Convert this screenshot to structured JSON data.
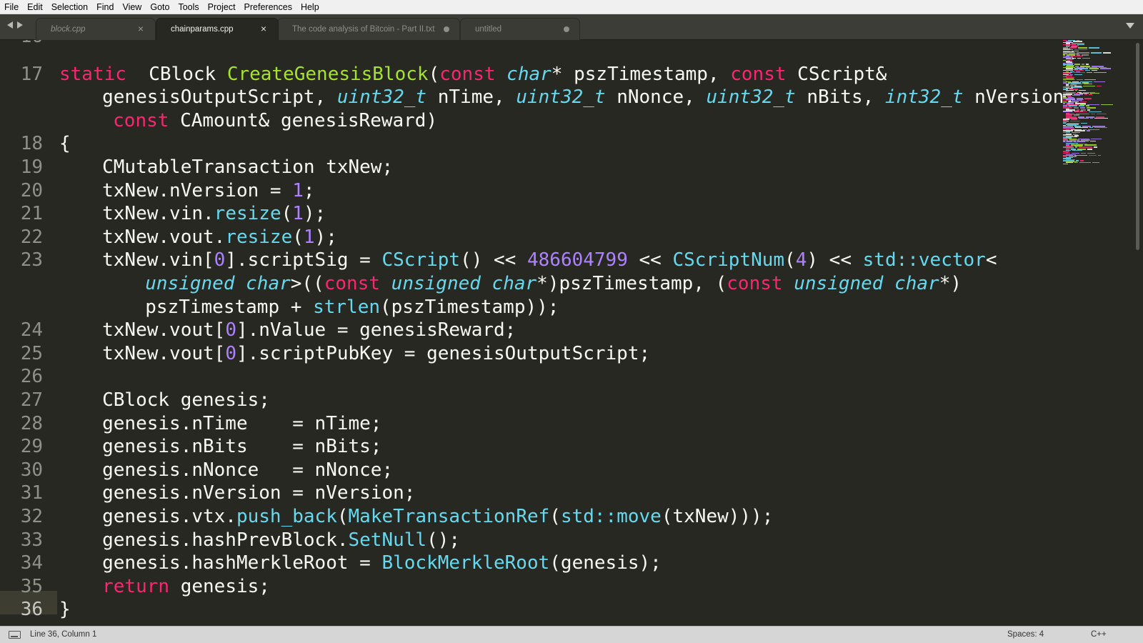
{
  "menu": [
    "File",
    "Edit",
    "Selection",
    "Find",
    "View",
    "Goto",
    "Tools",
    "Project",
    "Preferences",
    "Help"
  ],
  "tabs": [
    {
      "label": "block.cpp",
      "state": "close"
    },
    {
      "label": "chainparams.cpp",
      "state": "close",
      "active": true
    },
    {
      "label": "The code analysis of Bitcoin - Part II.txt",
      "state": "dirty"
    },
    {
      "label": "untitled",
      "state": "dirty"
    }
  ],
  "icons": {
    "nav_back": "triangle-left-icon",
    "nav_forward": "triangle-right-icon",
    "tab_close": "close-icon",
    "tab_dirty": "dot-icon",
    "overflow": "chevron-down-icon",
    "panel": "panel-toggle-icon"
  },
  "gutter": [
    {
      "n": "16",
      "row": -0.6
    },
    {
      "n": "17",
      "row": 1
    },
    {
      "n": "18",
      "row": 4
    },
    {
      "n": "19",
      "row": 5
    },
    {
      "n": "20",
      "row": 6
    },
    {
      "n": "21",
      "row": 7
    },
    {
      "n": "22",
      "row": 8
    },
    {
      "n": "23",
      "row": 9
    },
    {
      "n": "24",
      "row": 12
    },
    {
      "n": "25",
      "row": 13
    },
    {
      "n": "26",
      "row": 14
    },
    {
      "n": "27",
      "row": 15
    },
    {
      "n": "28",
      "row": 16
    },
    {
      "n": "29",
      "row": 17
    },
    {
      "n": "30",
      "row": 18
    },
    {
      "n": "31",
      "row": 19
    },
    {
      "n": "32",
      "row": 20
    },
    {
      "n": "33",
      "row": 21
    },
    {
      "n": "34",
      "row": 22
    },
    {
      "n": "35",
      "row": 23
    },
    {
      "n": "36",
      "row": 24
    }
  ],
  "code": [
    {
      "row": 1,
      "indent": 0,
      "tokens": [
        [
          "kw",
          "static"
        ],
        [
          "",
          "  CBlock "
        ],
        [
          "fn",
          "CreateGenesisBlock"
        ],
        [
          "",
          "("
        ],
        [
          "kw",
          "const"
        ],
        [
          "",
          " "
        ],
        [
          "ty",
          "char"
        ],
        [
          "",
          "* pszTimestamp, "
        ],
        [
          "kw",
          "const"
        ],
        [
          "",
          " CScript&"
        ]
      ]
    },
    {
      "row": 2,
      "indent": 2.4,
      "tokens": [
        [
          "",
          "genesisOutputScript, "
        ],
        [
          "ty",
          "uint32_t"
        ],
        [
          "",
          " nTime, "
        ],
        [
          "ty",
          "uint32_t"
        ],
        [
          "",
          " nNonce, "
        ],
        [
          "ty",
          "uint32_t"
        ],
        [
          "",
          " nBits, "
        ],
        [
          "ty",
          "int32_t"
        ],
        [
          "",
          " nVersion,"
        ]
      ]
    },
    {
      "row": 3,
      "indent": 3,
      "tokens": [
        [
          "kw",
          "const"
        ],
        [
          "",
          " CAmount& genesisReward)"
        ]
      ]
    },
    {
      "row": 4,
      "indent": 0,
      "tokens": [
        [
          "",
          "{"
        ]
      ]
    },
    {
      "row": 5,
      "indent": 2.4,
      "tokens": [
        [
          "",
          "CMutableTransaction txNew;"
        ]
      ]
    },
    {
      "row": 6,
      "indent": 2.4,
      "tokens": [
        [
          "",
          "txNew.nVersion = "
        ],
        [
          "nm",
          "1"
        ],
        [
          "",
          ";"
        ]
      ]
    },
    {
      "row": 7,
      "indent": 2.4,
      "tokens": [
        [
          "",
          "txNew.vin."
        ],
        [
          "cf",
          "resize"
        ],
        [
          "",
          "("
        ],
        [
          "nm",
          "1"
        ],
        [
          "",
          ");"
        ]
      ]
    },
    {
      "row": 8,
      "indent": 2.4,
      "tokens": [
        [
          "",
          "txNew.vout."
        ],
        [
          "cf",
          "resize"
        ],
        [
          "",
          "("
        ],
        [
          "nm",
          "1"
        ],
        [
          "",
          ");"
        ]
      ]
    },
    {
      "row": 9,
      "indent": 2.4,
      "tokens": [
        [
          "",
          "txNew.vin["
        ],
        [
          "nm",
          "0"
        ],
        [
          "",
          "].scriptSig = "
        ],
        [
          "cf",
          "CScript"
        ],
        [
          "",
          "() << "
        ],
        [
          "nm",
          "486604799"
        ],
        [
          "",
          " << "
        ],
        [
          "cf",
          "CScriptNum"
        ],
        [
          "",
          "("
        ],
        [
          "nm",
          "4"
        ],
        [
          "",
          ") << "
        ],
        [
          "cf",
          "std::vector"
        ],
        [
          "",
          "<"
        ]
      ]
    },
    {
      "row": 10,
      "indent": 4.8,
      "tokens": [
        [
          "ty",
          "unsigned char"
        ],
        [
          "",
          ">(("
        ],
        [
          "kw",
          "const"
        ],
        [
          "",
          " "
        ],
        [
          "ty",
          "unsigned char"
        ],
        [
          "",
          "*)pszTimestamp, ("
        ],
        [
          "kw",
          "const"
        ],
        [
          "",
          " "
        ],
        [
          "ty",
          "unsigned char"
        ],
        [
          "",
          "*)"
        ]
      ]
    },
    {
      "row": 11,
      "indent": 4.8,
      "tokens": [
        [
          "",
          "pszTimestamp + "
        ],
        [
          "cf",
          "strlen"
        ],
        [
          "",
          "(pszTimestamp));"
        ]
      ]
    },
    {
      "row": 12,
      "indent": 2.4,
      "tokens": [
        [
          "",
          "txNew.vout["
        ],
        [
          "nm",
          "0"
        ],
        [
          "",
          "].nValue = genesisReward;"
        ]
      ]
    },
    {
      "row": 13,
      "indent": 2.4,
      "tokens": [
        [
          "",
          "txNew.vout["
        ],
        [
          "nm",
          "0"
        ],
        [
          "",
          "].scriptPubKey = genesisOutputScript;"
        ]
      ]
    },
    {
      "row": 15,
      "indent": 2.4,
      "tokens": [
        [
          "",
          "CBlock genesis;"
        ]
      ]
    },
    {
      "row": 16,
      "indent": 2.4,
      "tokens": [
        [
          "",
          "genesis.nTime    = nTime;"
        ]
      ]
    },
    {
      "row": 17,
      "indent": 2.4,
      "tokens": [
        [
          "",
          "genesis.nBits    = nBits;"
        ]
      ]
    },
    {
      "row": 18,
      "indent": 2.4,
      "tokens": [
        [
          "",
          "genesis.nNonce   = nNonce;"
        ]
      ]
    },
    {
      "row": 19,
      "indent": 2.4,
      "tokens": [
        [
          "",
          "genesis.nVersion = nVersion;"
        ]
      ]
    },
    {
      "row": 20,
      "indent": 2.4,
      "tokens": [
        [
          "",
          "genesis.vtx."
        ],
        [
          "cf",
          "push_back"
        ],
        [
          "",
          "("
        ],
        [
          "cf",
          "MakeTransactionRef"
        ],
        [
          "",
          "("
        ],
        [
          "cf",
          "std::move"
        ],
        [
          "",
          "(txNew)));"
        ]
      ]
    },
    {
      "row": 21,
      "indent": 2.4,
      "tokens": [
        [
          "",
          "genesis.hashPrevBlock."
        ],
        [
          "cf",
          "SetNull"
        ],
        [
          "",
          "();"
        ]
      ]
    },
    {
      "row": 22,
      "indent": 2.4,
      "tokens": [
        [
          "",
          "genesis.hashMerkleRoot = "
        ],
        [
          "cf",
          "BlockMerkleRoot"
        ],
        [
          "",
          "(genesis);"
        ]
      ]
    },
    {
      "row": 23,
      "indent": 2.4,
      "tokens": [
        [
          "kw",
          "return"
        ],
        [
          "",
          " genesis;"
        ]
      ]
    },
    {
      "row": 24,
      "indent": 0,
      "tokens": [
        [
          "",
          "}"
        ]
      ]
    }
  ],
  "status": {
    "position": "Line 36, Column 1",
    "spaces": "Spaces: 4",
    "syntax": "C++"
  },
  "colors": {
    "background": "#272822",
    "keyword": "#f92672",
    "function": "#a6e22e",
    "type": "#66d9ef",
    "number": "#ae81ff"
  }
}
